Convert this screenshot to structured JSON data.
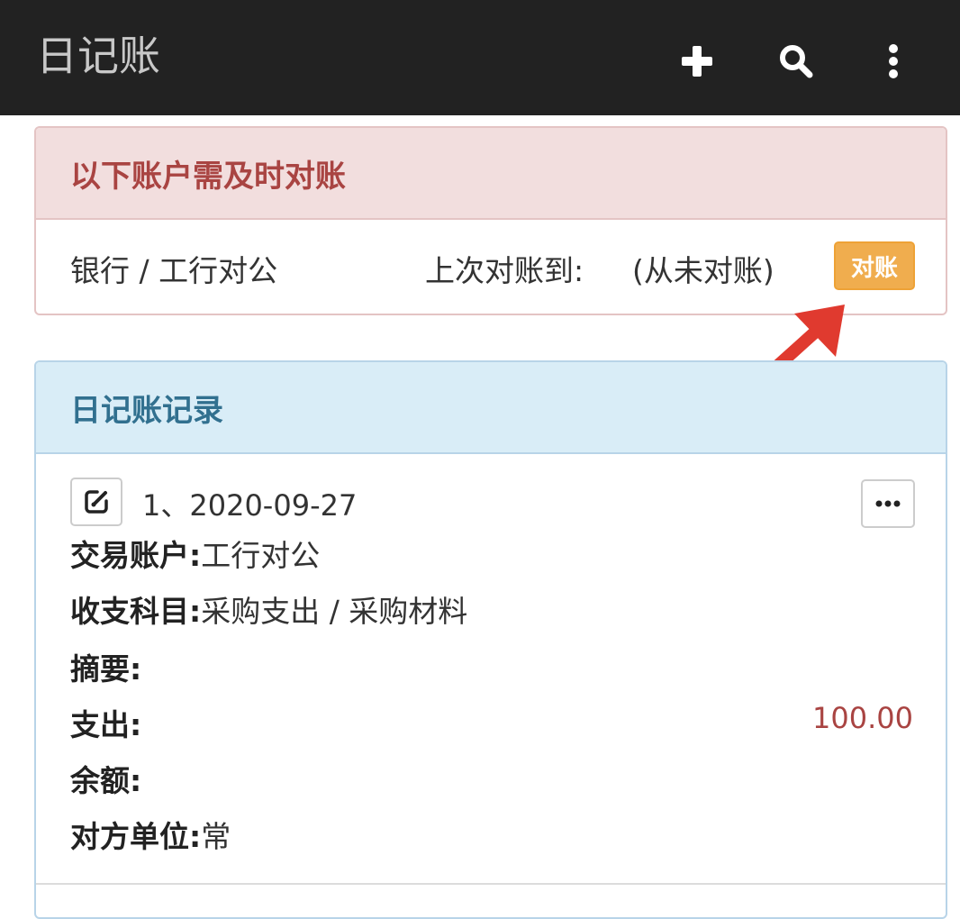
{
  "app": {
    "title": "日记账"
  },
  "toolbar": {
    "icons": [
      "plus-icon",
      "search-icon",
      "more-vertical-icon"
    ]
  },
  "reconcile_panel": {
    "heading": "以下账户需及时对账",
    "account": "银行 / 工行对公",
    "last_label": "上次对账到:",
    "last_value": "(从未对账)",
    "button_label": "对账",
    "accent_color": "#f0ad4e"
  },
  "records_panel": {
    "heading": "日记账记录",
    "record": {
      "title": "1、2020-09-27",
      "account_label": "交易账户:",
      "account_value": "工行对公",
      "category_label": "收支科目:",
      "category_value": "采购支出 / 采购材料",
      "summary_label": "摘要:",
      "summary_value": "",
      "expense_label": "支出:",
      "expense_value": "100.00",
      "balance_label": "余额:",
      "balance_value": "",
      "counterparty_label": "对方单位:",
      "counterparty_value": "常"
    }
  },
  "colors": {
    "navbar": "#222222",
    "danger_heading": "#a94442",
    "info_heading": "#31708f",
    "amount": "#a94442"
  }
}
